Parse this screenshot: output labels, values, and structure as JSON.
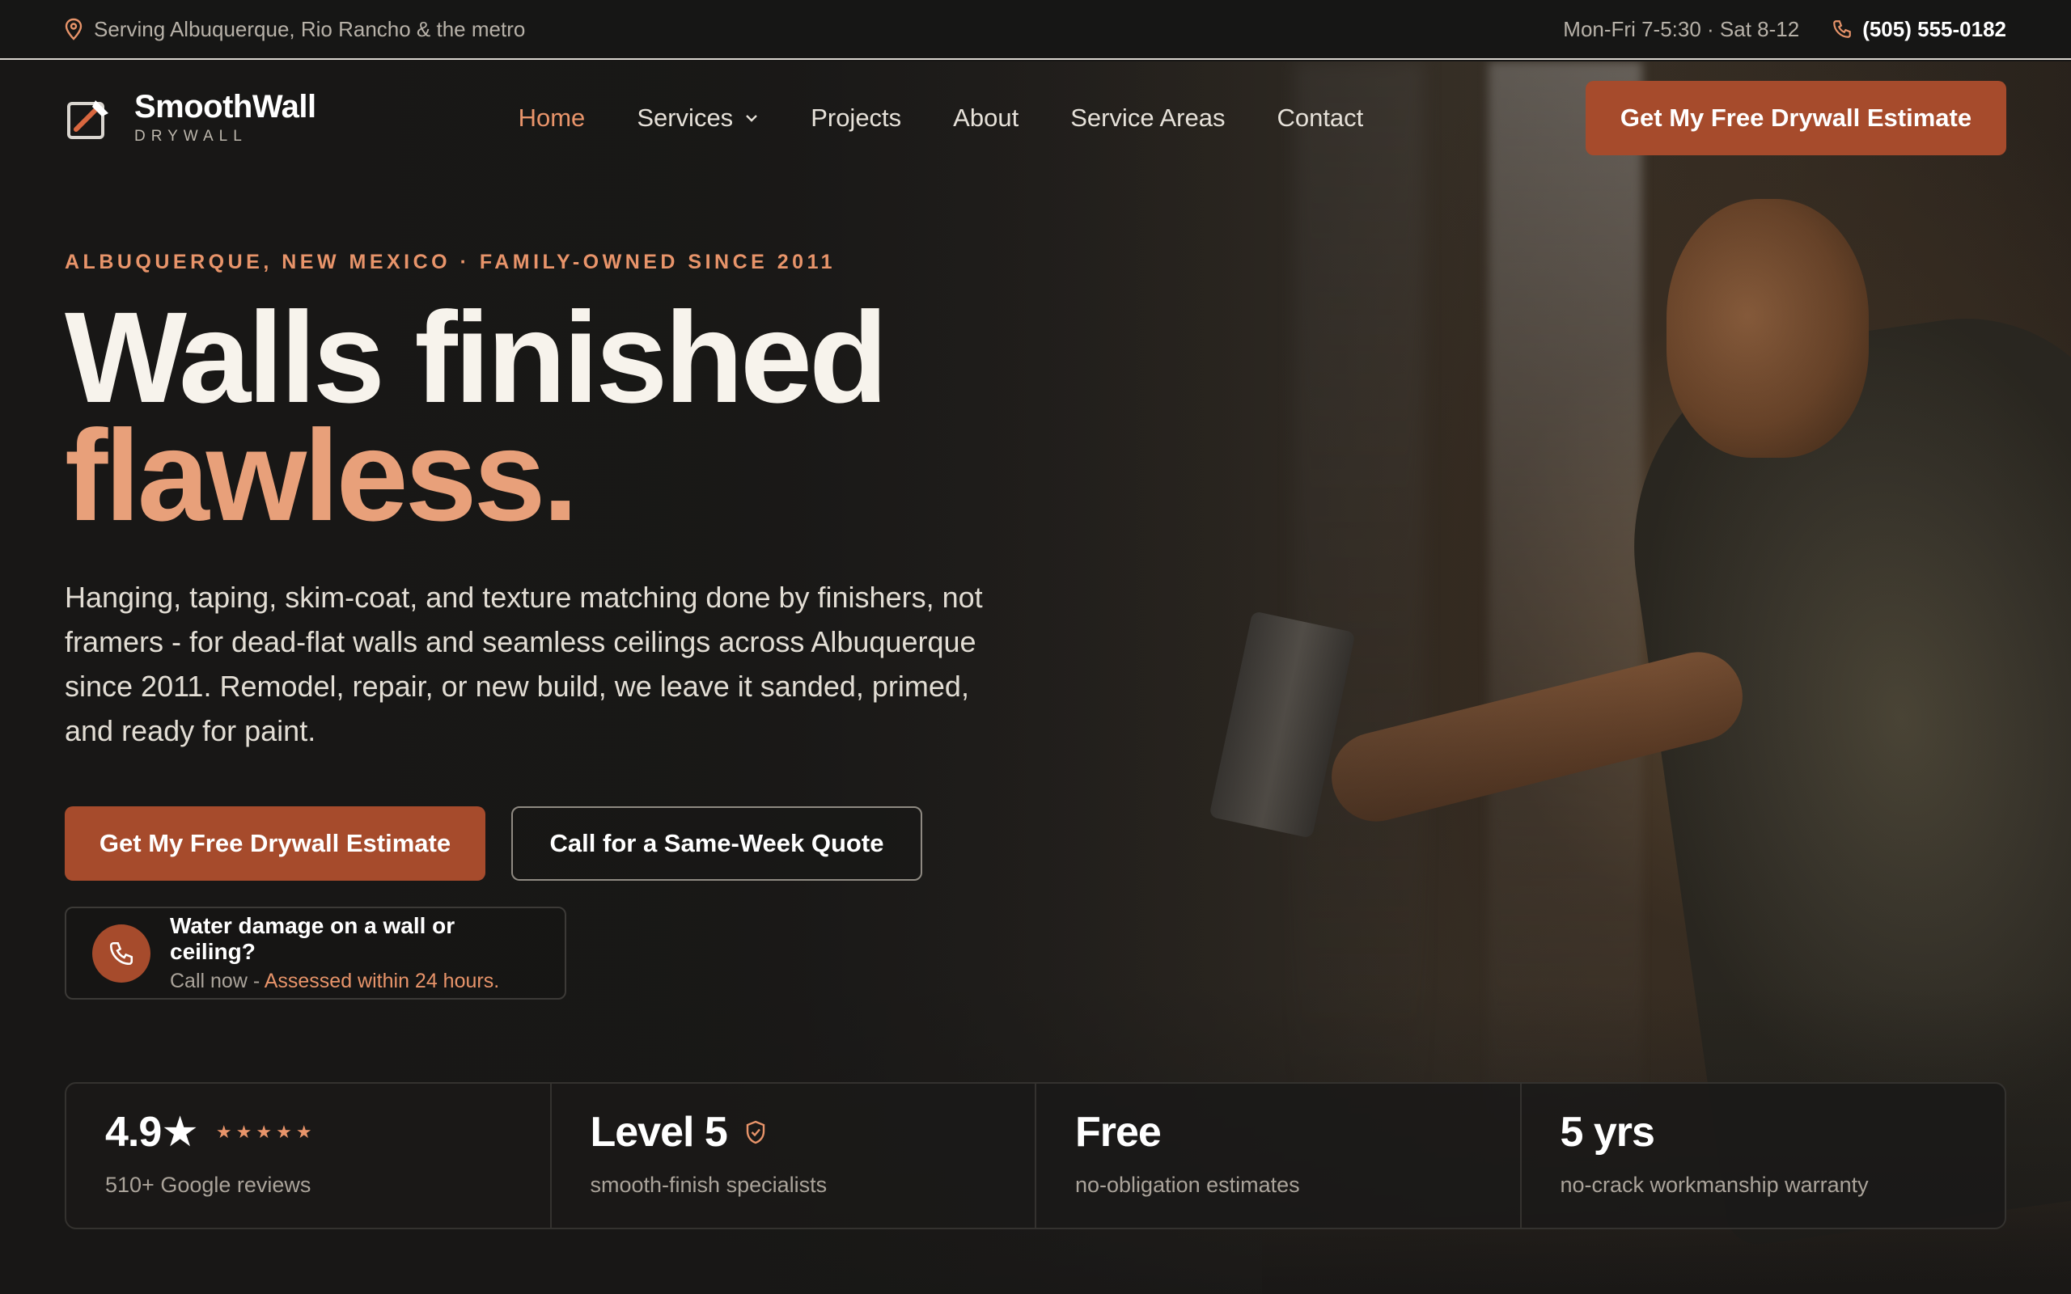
{
  "topbar": {
    "service_area": "Serving Albuquerque, Rio Rancho & the metro",
    "hours": "Mon-Fri 7-5:30 · Sat 8-12",
    "phone": "(505) 555-0182"
  },
  "brand": {
    "name": "SmoothWall",
    "tagline": "DRYWALL",
    "accent_color": "#a64b2c",
    "highlight_color": "#e8946a"
  },
  "nav": {
    "items": [
      {
        "label": "Home",
        "active": true
      },
      {
        "label": "Services",
        "has_dropdown": true
      },
      {
        "label": "Projects"
      },
      {
        "label": "About"
      },
      {
        "label": "Service Areas"
      },
      {
        "label": "Contact"
      }
    ],
    "cta_label": "Get My Free Drywall Estimate"
  },
  "hero": {
    "eyebrow": "ALBUQUERQUE, NEW MEXICO · FAMILY-OWNED SINCE 2011",
    "headline_line1": "Walls finished",
    "headline_line2": "flawless.",
    "lede": "Hanging, taping, skim-coat, and texture matching done by finishers, not framers - for dead-flat walls and seamless ceilings across Albuquerque since 2011. Remodel, repair, or new build, we leave it sanded, primed, and ready for paint.",
    "primary_cta": "Get My Free Drywall Estimate",
    "secondary_cta": "Call for a Same-Week Quote",
    "alert": {
      "title": "Water damage on a wall or ceiling?",
      "prefix": "Call now - ",
      "highlight": "Assessed within 24 hours."
    }
  },
  "stats": [
    {
      "value": "4.9★",
      "label": "510+ Google reviews",
      "stars": 5
    },
    {
      "value": "Level 5",
      "label": "smooth-finish specialists",
      "icon": "shield-icon"
    },
    {
      "value": "Free",
      "label": "no-obligation estimates"
    },
    {
      "value": "5 yrs",
      "label": "no-crack workmanship warranty"
    }
  ]
}
